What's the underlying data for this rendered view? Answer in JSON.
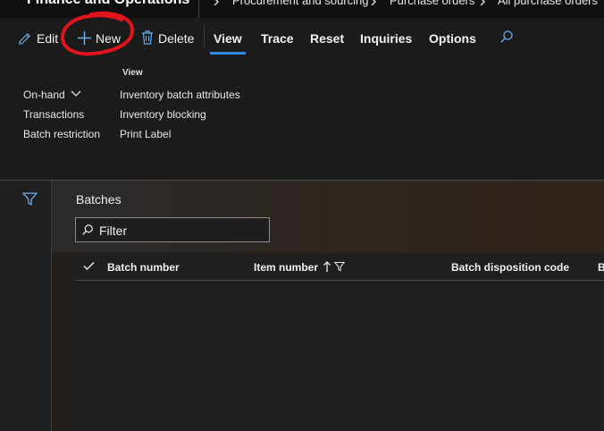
{
  "app": {
    "title": "Finance and Operations"
  },
  "breadcrumb": [
    "Procurement and sourcing",
    "Purchase orders",
    "All purchase orders"
  ],
  "actions": {
    "edit": "Edit",
    "new": "New",
    "delete": "Delete",
    "tabs": [
      "View",
      "Trace",
      "Reset",
      "Inquiries",
      "Options"
    ],
    "active_tab": "View"
  },
  "menu": {
    "group_view_title": "View",
    "col1": [
      "On-hand",
      "Transactions",
      "Batch restriction"
    ],
    "col2": [
      "Inventory batch attributes",
      "Inventory blocking",
      "Print Label"
    ]
  },
  "main": {
    "section_title": "Batches",
    "filter_placeholder": "Filter",
    "columns": [
      "Batch number",
      "Item number",
      "Batch disposition code",
      "B"
    ]
  },
  "colors": {
    "accent": "#2f8ce8",
    "annotation": "#e0141c"
  },
  "icons": [
    "pencil-icon",
    "plus-icon",
    "trash-icon",
    "search-icon",
    "filter-icon",
    "chevron-down-icon",
    "checkmark-icon",
    "sort-up-icon"
  ]
}
